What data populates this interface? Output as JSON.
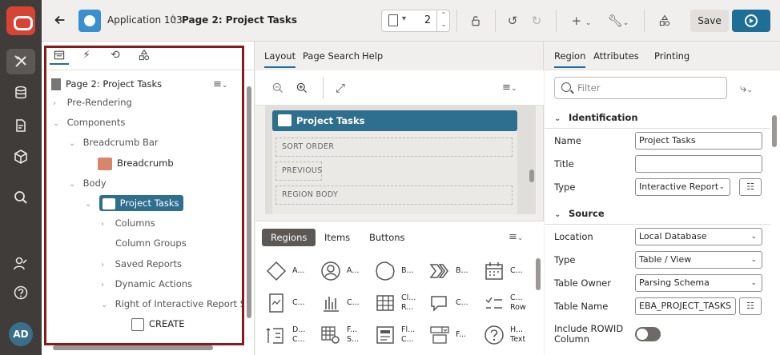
{
  "topbar": {
    "app_crumb": "Application 103",
    "page_crumb": "Page 2: Project Tasks",
    "page_number": "2",
    "save_label": "Save"
  },
  "rail": {
    "avatar_initials": "AD"
  },
  "tree": {
    "page_label": "Page 2: Project Tasks",
    "rows": {
      "pre_rendering": "Pre-Rendering",
      "components": "Components",
      "breadcrumb_bar": "Breadcrumb Bar",
      "breadcrumb": "Breadcrumb",
      "body": "Body",
      "project_tasks": "Project Tasks",
      "columns": "Columns",
      "column_groups": "Column Groups",
      "saved_reports": "Saved Reports",
      "dynamic_actions": "Dynamic Actions",
      "right_of_ir_search": "Right of Interactive Report Search",
      "create": "CREATE"
    }
  },
  "layout": {
    "tabs": [
      "Layout",
      "Page Search",
      "Help"
    ],
    "region_title": "Project Tasks",
    "slots": [
      "SORT ORDER",
      "PREVIOUS",
      "REGION BODY"
    ],
    "gallery_tabs": [
      "Regions",
      "Items",
      "Buttons"
    ],
    "gallery_items": [
      {
        "icon": "diamond-icon",
        "l1": "A...",
        "l2": ""
      },
      {
        "icon": "avatar-icon",
        "l1": "A...",
        "l2": ""
      },
      {
        "icon": "badge-icon",
        "l1": "B...",
        "l2": ""
      },
      {
        "icon": "breadcrumb-icon",
        "l1": "B...",
        "l2": ""
      },
      {
        "icon": "calendar-icon",
        "l1": "C...",
        "l2": ""
      },
      {
        "icon": "card-icon",
        "l1": "C...",
        "l2": ""
      },
      {
        "icon": "chart-icon",
        "l1": "C...",
        "l2": ""
      },
      {
        "icon": "classic-report-icon",
        "l1": "Cl...",
        "l2": "R..."
      },
      {
        "icon": "comments-icon",
        "l1": "C...",
        "l2": ""
      },
      {
        "icon": "content-row-icon",
        "l1": "C...",
        "l2": "Row"
      },
      {
        "icon": "dynamic-content-icon",
        "l1": "D...",
        "l2": "C..."
      },
      {
        "icon": "faceted-search-icon",
        "l1": "F...",
        "l2": "S..."
      },
      {
        "icon": "flow-icon",
        "l1": "Fl...",
        "l2": "C..."
      },
      {
        "icon": "form-icon",
        "l1": "F...",
        "l2": ""
      },
      {
        "icon": "help-text-icon",
        "l1": "H...",
        "l2": "Text"
      }
    ]
  },
  "properties": {
    "tabs": [
      "Region",
      "Attributes",
      "Printing"
    ],
    "filter_placeholder": "Filter",
    "identification": {
      "header": "Identification",
      "name_label": "Name",
      "name_value": "Project Tasks",
      "title_label": "Title",
      "title_value": "",
      "type_label": "Type",
      "type_value": "Interactive Report"
    },
    "source": {
      "header": "Source",
      "location_label": "Location",
      "location_value": "Local Database",
      "type_label": "Type",
      "type_value": "Table / View",
      "owner_label": "Table Owner",
      "owner_value": "Parsing Schema",
      "table_label": "Table Name",
      "table_value": "EBA_PROJECT_TASKS",
      "rowid_label": "Include ROWID Column"
    }
  },
  "colors": {
    "accent": "#1e6f97",
    "highlight_border": "#8a1a1a",
    "rail_bg": "#3f3c3a"
  }
}
